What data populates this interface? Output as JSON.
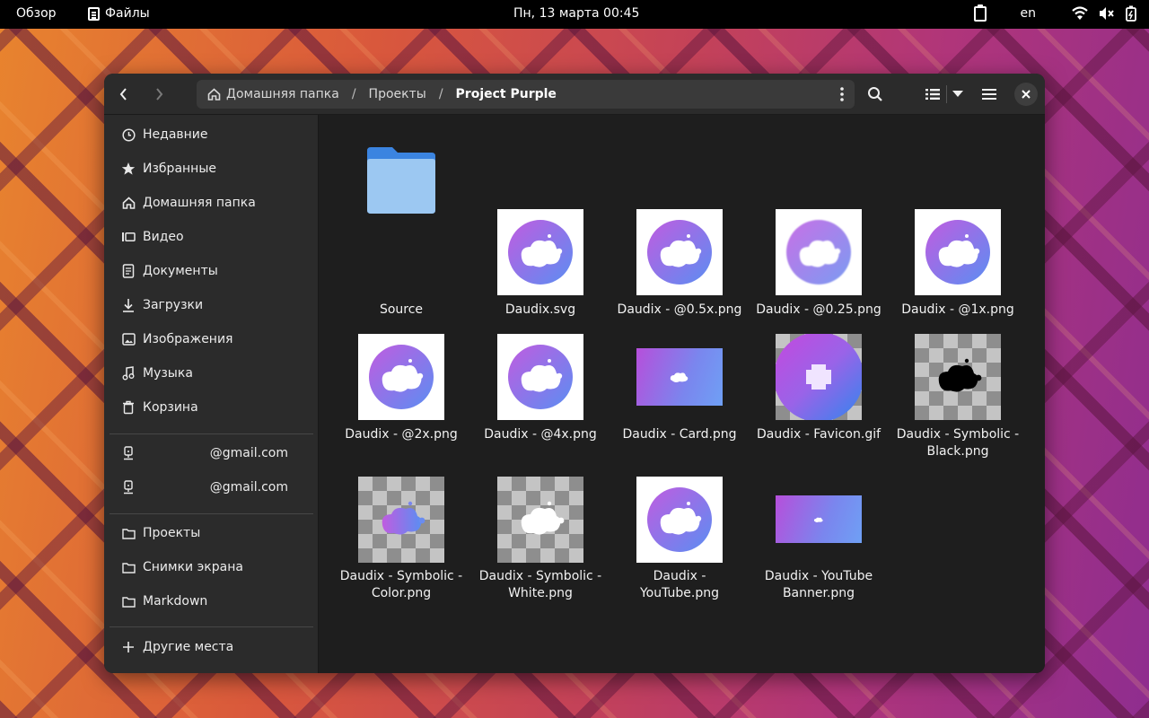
{
  "topbar": {
    "overview": "Обзор",
    "app_name": "Файлы",
    "clock": "Пн, 13 марта  00:45",
    "lang": "en",
    "icons": [
      "clipboard-icon",
      "wifi-icon",
      "volume-muted-icon",
      "battery-icon"
    ]
  },
  "header": {
    "back_icon": "chevron-left-icon",
    "forward_icon": "chevron-right-icon",
    "breadcrumb": [
      {
        "label": "Домашняя папка",
        "icon": "home-icon"
      },
      {
        "label": "Проекты"
      },
      {
        "label": "Project Purple"
      }
    ],
    "path_menu_icon": "kebab-menu-icon",
    "search_icon": "search-icon",
    "view_icon": "list-view-icon",
    "view_dropdown_icon": "caret-down-icon",
    "menu_icon": "hamburger-menu-icon",
    "close_icon": "close-icon"
  },
  "sidebar": {
    "places": [
      {
        "label": "Недавние",
        "icon": "clock-icon"
      },
      {
        "label": "Избранные",
        "icon": "star-icon"
      },
      {
        "label": "Домашняя папка",
        "icon": "home-icon"
      },
      {
        "label": "Видео",
        "icon": "video-icon"
      },
      {
        "label": "Документы",
        "icon": "document-icon"
      },
      {
        "label": "Загрузки",
        "icon": "download-icon"
      },
      {
        "label": "Изображения",
        "icon": "image-icon"
      },
      {
        "label": "Музыка",
        "icon": "music-icon"
      },
      {
        "label": "Корзина",
        "icon": "trash-icon"
      }
    ],
    "accounts": [
      {
        "label": "@gmail.com",
        "icon": "remote-drive-icon"
      },
      {
        "label": "@gmail.com",
        "icon": "remote-drive-icon"
      }
    ],
    "bookmarks": [
      {
        "label": "Проекты",
        "icon": "folder-icon"
      },
      {
        "label": "Снимки экрана",
        "icon": "folder-icon"
      },
      {
        "label": "Markdown",
        "icon": "folder-icon"
      }
    ],
    "other": {
      "label": "Другие места",
      "icon": "plus-icon"
    }
  },
  "files": [
    {
      "name": "Source",
      "kind": "folder"
    },
    {
      "name": "Daudix.svg",
      "kind": "logo"
    },
    {
      "name": "Daudix - @0.5x.png",
      "kind": "logo"
    },
    {
      "name": "Daudix - @0.25.png",
      "kind": "logo-blur"
    },
    {
      "name": "Daudix - @1x.png",
      "kind": "logo"
    },
    {
      "name": "Daudix - @2x.png",
      "kind": "logo"
    },
    {
      "name": "Daudix - @4x.png",
      "kind": "logo"
    },
    {
      "name": "Daudix - Card.png",
      "kind": "card"
    },
    {
      "name": "Daudix - Favicon.gif",
      "kind": "favicon"
    },
    {
      "name": "Daudix - Symbolic - Black.png",
      "kind": "symbolic-black"
    },
    {
      "name": "Daudix - Symbolic - Color.png",
      "kind": "symbolic-color"
    },
    {
      "name": "Daudix - Symbolic - White.png",
      "kind": "symbolic-white"
    },
    {
      "name": "Daudix - YouTube.png",
      "kind": "logo"
    },
    {
      "name": "Daudix - YouTube Banner.png",
      "kind": "banner"
    }
  ],
  "colors": {
    "accent_purple": "#b45ee0",
    "accent_blue": "#6b8ef0",
    "folder_blue": "#5aa0e8",
    "window_bg": "#1e1e1e",
    "sidebar_bg": "#2b2b2b"
  }
}
